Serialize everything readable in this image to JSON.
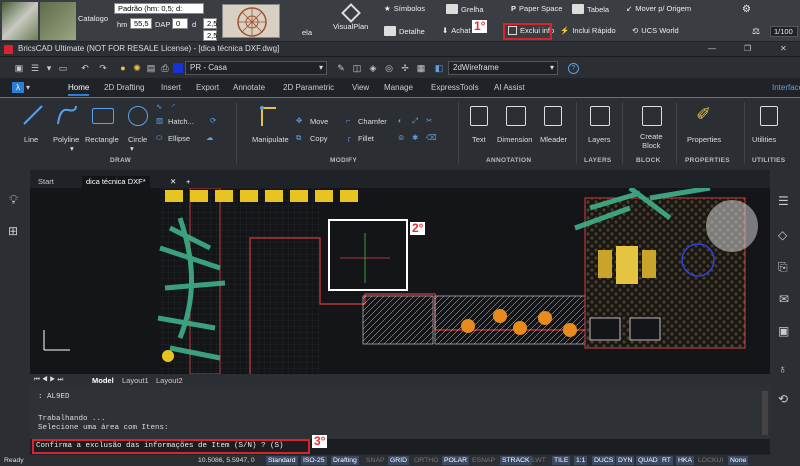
{
  "top_toolbar": {
    "catalog_label": "Catalogo",
    "layer_value": "Padrão (hm: 0,5; d:",
    "hm_label": "hm",
    "hm_value": "55,5",
    "dap_label": "DAP",
    "dap_value": "0",
    "d_label": "d",
    "d_value": "2,5",
    "scale_value": "1/100",
    "buttons": {
      "simbolos": "Símbolos",
      "grelha": "Grelha",
      "paper_space": "Paper Space",
      "tabela": "Tabela",
      "mover_origem": "Mover p/ Origem",
      "visualplan": "VisualPlan",
      "detalhe": "Detalhe",
      "achat": "Achat",
      "exclui_info": "Exclui info",
      "inclui_rapido": "Inclui Rápido",
      "ucs_world": "UCS World",
      "ela": "ela"
    }
  },
  "markers": {
    "m1": "1°",
    "m2": "2°",
    "m3": "3°"
  },
  "window": {
    "title": "BricsCAD Ultimate (NOT FOR RESALE License) - [dica técnica DXF.dwg]"
  },
  "quick_access": {
    "layer_combo": "PR - Casa",
    "visual_style": "2dWireframe"
  },
  "ribbon_tabs": [
    "Home",
    "2D Drafting",
    "Insert",
    "Export",
    "Annotate",
    "2D Parametric",
    "View",
    "Manage",
    "ExpressTools",
    "AI Assist"
  ],
  "ribbon_right_tab": "Interface",
  "ribbon": {
    "draw": {
      "line": "Line",
      "polyline": "Polyline",
      "rectangle": "Rectangle",
      "circle": "Circle",
      "hatch": "Hatch...",
      "ellipse": "Ellipse",
      "group": "DRAW"
    },
    "modify": {
      "manipulate": "Manipulate",
      "move": "Move",
      "copy": "Copy",
      "chamfer": "Chamfer",
      "fillet": "Fillet",
      "group": "MODIFY"
    },
    "annotation": {
      "text": "Text",
      "dimension": "Dimension",
      "mleader": "Mleader",
      "group": "ANNOTATION"
    },
    "layers": {
      "layers": "Layers",
      "group": "LAYERS"
    },
    "block": {
      "create": "Create\nBlock",
      "group": "BLOCK"
    },
    "properties": {
      "properties": "Properties",
      "group": "PROPERTIES"
    },
    "utilities": {
      "utilities": "Utilities",
      "group": "UTILITIES"
    }
  },
  "doc_tabs": [
    "Start",
    "dica técnica DXF*"
  ],
  "layout_tabs": [
    "Model",
    "Layout1",
    "Layout2"
  ],
  "command": {
    "line1": ": AL9ED",
    "line2": "Trabalhando ...",
    "line3": "Selecione uma área com Itens:",
    "prompt": "Confirma a exclusão das informações de Item (S/N) ? (S)"
  },
  "status_bar": {
    "ready": "Ready",
    "coords": "10.5086, 5.5947, 0",
    "items": [
      {
        "label": "Standard",
        "state": "on"
      },
      {
        "label": "ISO-25",
        "state": "on"
      },
      {
        "label": "Drafting",
        "state": "on"
      },
      {
        "label": "SNAP",
        "state": "off"
      },
      {
        "label": "GRID",
        "state": "on"
      },
      {
        "label": "ORTHO",
        "state": "off"
      },
      {
        "label": "POLAR",
        "state": "on"
      },
      {
        "label": "ESNAP",
        "state": "off"
      },
      {
        "label": "STRACK",
        "state": "on"
      },
      {
        "label": "LWT",
        "state": "off"
      },
      {
        "label": "TILE",
        "state": "on"
      },
      {
        "label": "1:1",
        "state": "on"
      },
      {
        "label": "DUCS",
        "state": "on"
      },
      {
        "label": "DYN",
        "state": "on"
      },
      {
        "label": "QUAD",
        "state": "on"
      },
      {
        "label": "RT",
        "state": "on"
      },
      {
        "label": "HKA",
        "state": "on"
      },
      {
        "label": "LOCKUI",
        "state": "off"
      },
      {
        "label": "None",
        "state": "on"
      }
    ]
  }
}
